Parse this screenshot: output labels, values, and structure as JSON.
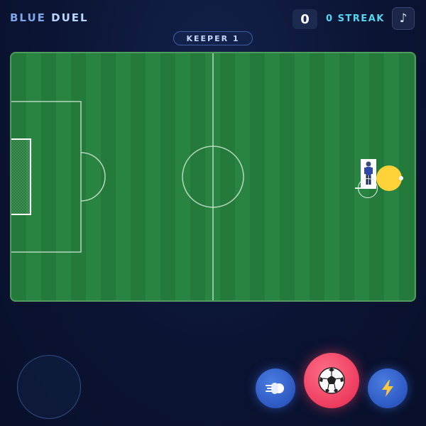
{
  "header": {
    "title_part1": "BLUE",
    "title_part2": "DUEL",
    "score": "0",
    "streak": "0 STREAK",
    "music_icon": "music-note-icon"
  },
  "status": {
    "keeper_label": "KEEPER 1"
  },
  "pitch": {
    "colors": {
      "grass_dark": "#247a3a",
      "grass_light": "#2a8441",
      "lines": "#cfe6d3"
    }
  },
  "field_objects": {
    "player_icon": "player-figure",
    "ball_icon": "ball-icon",
    "ball_glow_color": "#ffd23a",
    "aim_icon": "aim-ring"
  },
  "controls": {
    "joystick": "virtual-joystick",
    "dash_icon": "dash-icon",
    "shoot_icon": "soccer-ball-icon",
    "power_icon": "lightning-icon",
    "shoot_color": "#ee3c5f",
    "secondary_color": "#2d58c2"
  }
}
